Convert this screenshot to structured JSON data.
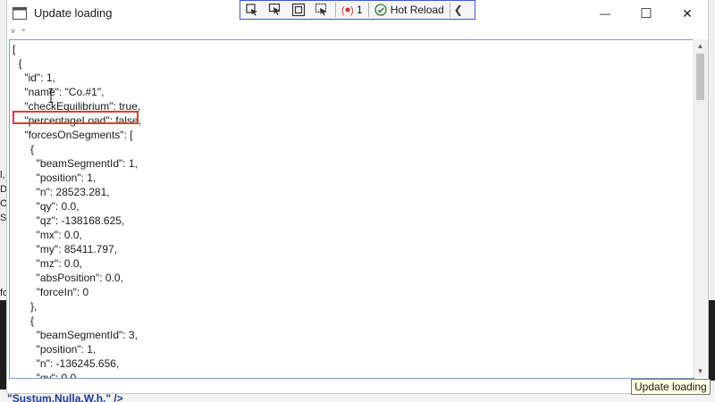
{
  "window": {
    "title": "Update loading",
    "minimize_glyph": "—",
    "maximize_glyph": "☐",
    "close_glyph": "✕"
  },
  "debug_toolbar": {
    "error_count": "1",
    "hot_reload_label": "Hot Reload",
    "collapse_glyph": "❮",
    "icons": [
      "select-element-icon",
      "pointer-icon",
      "display-layout-icon",
      "track-focus-icon",
      "error-icon",
      "check-circle-icon"
    ]
  },
  "toggle_glyph": "˅ ⁼",
  "editor": {
    "content": "[\n  {\n    \"id\": 1,\n    \"name\": \"Co.#1\",\n    \"checkEquilibrium\": true,\n    \"percentageLoad\": false,\n    \"forcesOnSegments\": [\n      {\n        \"beamSegmentId\": 1,\n        \"position\": 1,\n        \"n\": 28523.281,\n        \"qy\": 0.0,\n        \"qz\": -138168.625,\n        \"mx\": 0.0,\n        \"my\": 85411.797,\n        \"mz\": 0.0,\n        \"absPosition\": 0.0,\n        \"forceIn\": 0\n      },\n      {\n        \"beamSegmentId\": 3,\n        \"position\": 1,\n        \"n\": -136245.656,\n        \"qy\": 0.0",
    "highlighted_line": "\"percentageLoad\": false,"
  },
  "tooltip": "Update loading",
  "background": {
    "left_fragments": [
      "l,",
      "D",
      "O",
      "Se",
      "fo"
    ],
    "bottom_fragment": "\"Sustum.Nulla.W.h.\" />"
  },
  "colors": {
    "highlight": "#e53935",
    "debug_border": "#3a5bd8",
    "error": "#d32f2f",
    "hot_reload": "#2e7d32"
  }
}
